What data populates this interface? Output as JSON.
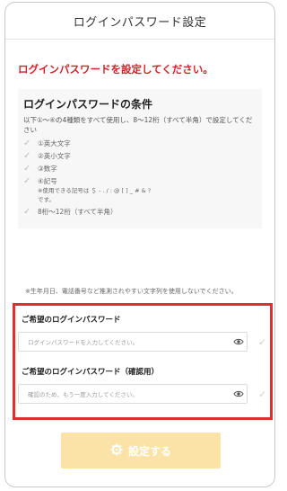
{
  "header": {
    "title": "ログインパスワード設定"
  },
  "lead_text": "ログインパスワードを設定してください。",
  "conditions": {
    "title": "ログインパスワードの条件",
    "description": "以下①～④の4種類をすべて使用し、8～12桁（すべて半角）で設定してください",
    "items": [
      {
        "label": "①英大文字"
      },
      {
        "label": "②英小文字"
      },
      {
        "label": "③数字"
      },
      {
        "label": "④記号",
        "sub1": "※使用できる記号は ＄ - . / : @ [ ] _ # & ?",
        "sub2": "です。"
      },
      {
        "label": "8桁～12桁（すべて半角）"
      }
    ]
  },
  "note": "※生年月日、電話番号など推測されやすい文字列を使用しないでください。",
  "form": {
    "password": {
      "label": "ご希望のログインパスワード",
      "placeholder": "ログインパスワードを入力してください。"
    },
    "confirm": {
      "label": "ご希望のログインパスワード（確認用）",
      "placeholder": "確認のため、もう一度入力してください。"
    }
  },
  "submit": {
    "label": "設定する"
  },
  "colors": {
    "accent_red": "#d2232a",
    "frame_red": "#e0302c",
    "button_bg": "#fbe3a8"
  },
  "icons": {
    "eye": "eye-icon",
    "check": "check-icon",
    "gear": "gear-icon"
  }
}
